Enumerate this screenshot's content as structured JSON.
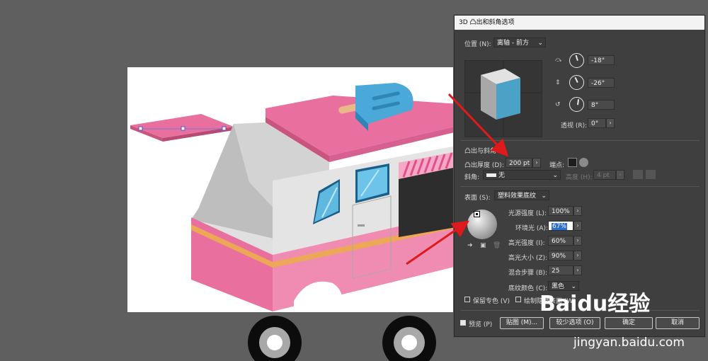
{
  "colors": {
    "pink": "#e86f9e",
    "light_pink": "#f08cb2",
    "blue": "#4aa9d8",
    "gray": "#d6d6d6",
    "dark_gray": "#bdbdbd",
    "orange": "#eda857",
    "accent_red": "#e0191c"
  },
  "dialog": {
    "title": "3D 凸出和斜角选项",
    "position_label": "位置 (N):",
    "position_value": "离轴 - 前方",
    "rot_x": "-18°",
    "rot_y": "-26°",
    "rot_z": "8°",
    "perspective_label": "透视 (R):",
    "perspective_value": "0°",
    "extrude_section": "凸出与斜角",
    "extrude_depth_label": "凸出厚度 (D):",
    "extrude_depth_value": "200 pt",
    "cap_label": "端点:",
    "bevel_label": "斜角:",
    "bevel_value": "无",
    "height_label": "高度 (H):",
    "height_value": "4 pt",
    "surface_label": "表面 (S):",
    "surface_value": "塑料效果底纹",
    "light_intensity_label": "光源强度 (L):",
    "light_intensity_value": "100%",
    "ambient_label": "环境光 (A):",
    "ambient_value": "67%",
    "highlight_intensity_label": "高光强度 (I):",
    "highlight_intensity_value": "60%",
    "highlight_size_label": "高光大小 (Z):",
    "highlight_size_value": "90%",
    "blend_steps_label": "混合步骤 (B):",
    "blend_steps_value": "25",
    "shading_color_label": "底纹颜色 (C):",
    "shading_color_value": "黑色",
    "preserve_spot_label": "保留专色 (V)",
    "draw_hidden_label": "绘制隐藏表面 (W)",
    "preview_label": "预览 (P)",
    "map_button": "贴图 (M)...",
    "fewer_options_button": "较少选项 (O)",
    "ok_button": "确定",
    "cancel_button": "取消"
  },
  "watermark": {
    "logo_text": "Baidu",
    "site_text": "经验",
    "url": "jingyan.baidu.com"
  }
}
